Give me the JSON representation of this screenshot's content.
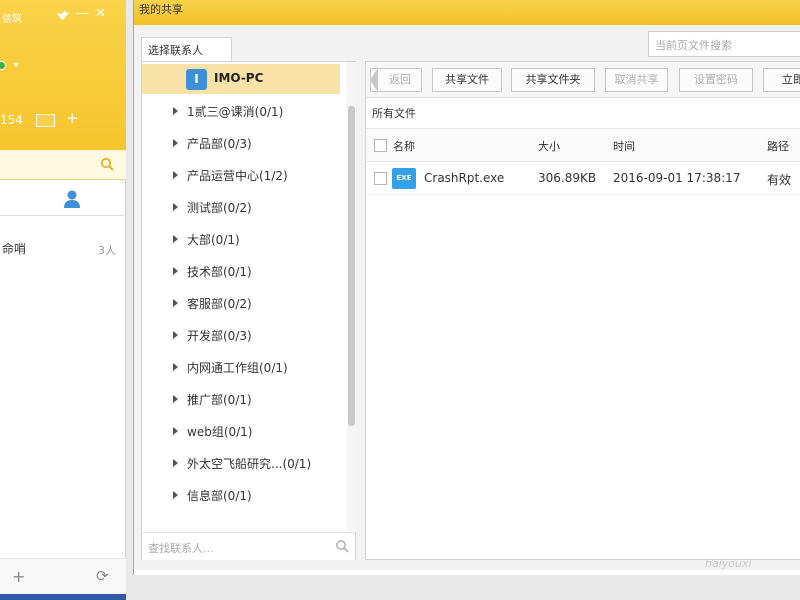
{
  "im": {
    "top_label": "信筑",
    "number": "154",
    "group_name": "命哨",
    "group_count": "3人"
  },
  "share": {
    "title": "我的共享",
    "contact_tab": "选择联系人",
    "file_search_placeholder": "当前页文件搜索",
    "contact_search_placeholder": "查找联系人...",
    "root": {
      "icon_letter": "I",
      "label": "IMO-PC"
    },
    "departments": [
      "1贰三@课消(0/1)",
      "产品部(0/3)",
      "产品运营中心(1/2)",
      "测试部(0/2)",
      "大部(0/1)",
      "技术部(0/1)",
      "客服部(0/2)",
      "开发部(0/3)",
      "内网通工作组(0/1)",
      "推广部(0/1)",
      "web组(0/1)",
      "外太空飞船研究...(0/1)",
      "信息部(0/1)"
    ],
    "toolbar": {
      "back": "返回",
      "share_file": "共享文件",
      "share_folder": "共享文件夹",
      "cancel_share": "取消共享",
      "set_password": "设置密码",
      "right_cut": "立即"
    },
    "path": "所有文件",
    "columns": {
      "name": "名称",
      "size": "大小",
      "time": "时间",
      "path": "路径"
    },
    "files": [
      {
        "icon": "EXE",
        "name": "CrashRpt.exe",
        "size": "306.89KB",
        "time": "2016-09-01 17:38:17",
        "path": "有效"
      }
    ]
  },
  "watermark": "haiyouxi"
}
